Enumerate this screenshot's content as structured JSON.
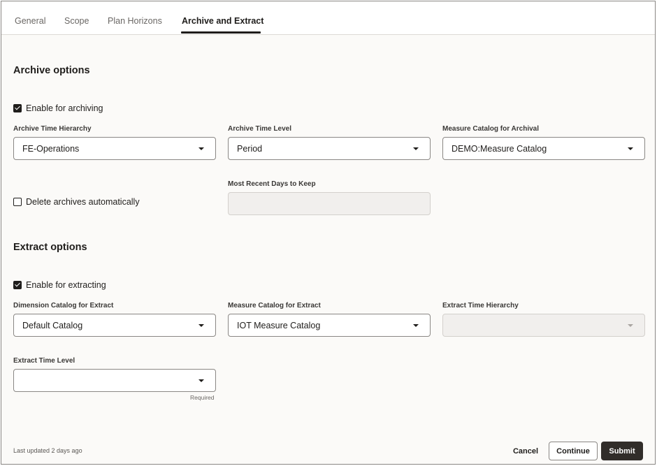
{
  "tabs": [
    {
      "label": "General",
      "active": false
    },
    {
      "label": "Scope",
      "active": false
    },
    {
      "label": "Plan Horizons",
      "active": false
    },
    {
      "label": "Archive and Extract",
      "active": true
    }
  ],
  "archive": {
    "title": "Archive options",
    "enable_label": "Enable for archiving",
    "enable_checked": true,
    "time_hierarchy": {
      "label": "Archive Time Hierarchy",
      "value": "FE-Operations"
    },
    "time_level": {
      "label": "Archive Time Level",
      "value": "Period"
    },
    "measure_catalog": {
      "label": "Measure Catalog for Archival",
      "value": "DEMO:Measure Catalog"
    },
    "delete_label": "Delete archives automatically",
    "delete_checked": false,
    "recent_days": {
      "label": "Most Recent Days to Keep",
      "value": "",
      "disabled": true
    }
  },
  "extract": {
    "title": "Extract options",
    "enable_label": "Enable for extracting",
    "enable_checked": true,
    "dimension_catalog": {
      "label": "Dimension Catalog for Extract",
      "value": "Default Catalog"
    },
    "measure_catalog": {
      "label": "Measure Catalog for Extract",
      "value": "IOT Measure Catalog"
    },
    "time_hierarchy": {
      "label": "Extract Time Hierarchy",
      "value": "",
      "disabled": true
    },
    "time_level": {
      "label": "Extract Time Level",
      "value": "",
      "helper": "Required"
    }
  },
  "footer": {
    "status": "Last updated 2 days ago",
    "cancel_label": "Cancel",
    "continue_label": "Continue",
    "submit_label": "Submit"
  },
  "colors": {
    "accent": "#1f1d1b",
    "submit_bg": "#312d2a",
    "page_bg": "#fbfaf8"
  },
  "icons": {
    "dropdown": "caret-down-icon",
    "checkbox": "checkmark-icon"
  }
}
